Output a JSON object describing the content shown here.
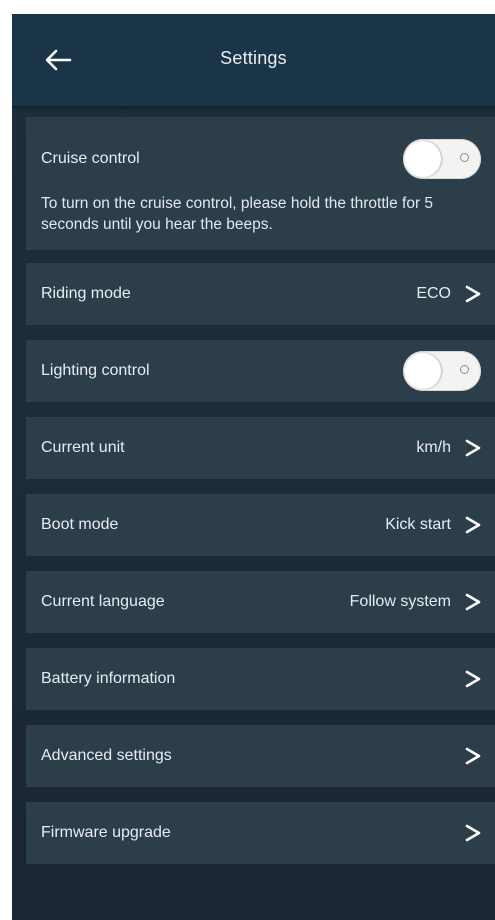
{
  "header": {
    "title": "Settings",
    "back_icon": "arrow-left-icon"
  },
  "settings": {
    "cruise": {
      "label": "Cruise control",
      "description": "To turn on the cruise control, please hold the throttle for 5 seconds until you hear the beeps.",
      "enabled": false
    },
    "riding_mode": {
      "label": "Riding mode",
      "value": "ECO"
    },
    "lighting": {
      "label": "Lighting control",
      "enabled": false
    },
    "current_unit": {
      "label": "Current unit",
      "value": "km/h"
    },
    "boot_mode": {
      "label": "Boot mode",
      "value": "Kick start"
    },
    "language": {
      "label": "Current language",
      "value": "Follow system"
    },
    "battery": {
      "label": "Battery information"
    },
    "advanced": {
      "label": "Advanced settings"
    },
    "firmware": {
      "label": "Firmware upgrade"
    }
  },
  "colors": {
    "header_bg": "#1a3448",
    "row_bg": "#2d3e4b",
    "text": "#e7ecf0",
    "toggle_off": "#f3f3f1"
  }
}
